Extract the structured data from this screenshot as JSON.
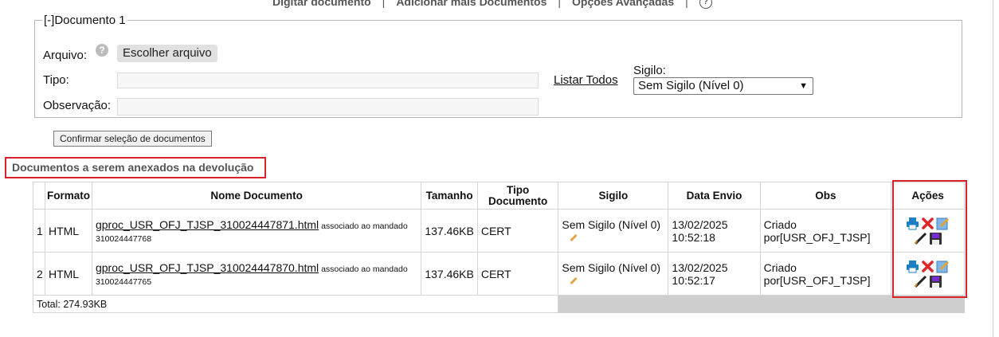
{
  "top_nav": {
    "items": [
      "Digitar documento",
      "Adicionar mais Documentos",
      "Opções Avançadas"
    ],
    "help": "?"
  },
  "fieldset": {
    "legend": "[-]Documento 1"
  },
  "form": {
    "arquivo_label": "Arquivo:",
    "help_icon": "?",
    "file_button": "Escolher arquivo",
    "tipo_label": "Tipo:",
    "tipo_value": "",
    "obs_label": "Observação:",
    "obs_value": "",
    "listar_todos": "Listar Todos",
    "sigilo_label": "Sigilo:",
    "sigilo_value": "Sem Sigilo (Nível 0)"
  },
  "confirm_button": "Confirmar seleção de documentos",
  "section_title": "Documentos a serem anexados na devolução",
  "table": {
    "headers": {
      "formato": "Formato",
      "nome": "Nome Documento",
      "tamanho": "Tamanho",
      "tipo": "Tipo Documento",
      "sigilo": "Sigilo",
      "data": "Data Envio",
      "obs": "Obs",
      "acoes": "Ações"
    },
    "rows": [
      {
        "index": "1",
        "formato": "HTML",
        "file_link": "gproc_USR_OFJ_TJSP_310024447871.html",
        "assoc": " associado ao mandado",
        "mandado": "310024447768",
        "tamanho": "137.46KB",
        "tipo": "CERT",
        "sigilo": "Sem Sigilo (Nível 0)",
        "data1": "13/02/2025",
        "data2": "10:52:18",
        "obs1": "Criado",
        "obs2": "por[USR_OFJ_TJSP]"
      },
      {
        "index": "2",
        "formato": "HTML",
        "file_link": "gproc_USR_OFJ_TJSP_310024447870.html",
        "assoc": " associado ao mandado",
        "mandado": "310024447765",
        "tamanho": "137.46KB",
        "tipo": "CERT",
        "sigilo": "Sem Sigilo (Nível 0)",
        "data1": "13/02/2025",
        "data2": "10:52:17",
        "obs1": "Criado",
        "obs2": "por[USR_OFJ_TJSP]"
      }
    ],
    "total": "Total: 274.93KB"
  },
  "action_icons": [
    "print-icon",
    "delete-icon",
    "edit-icon",
    "sign-icon",
    "save-icon"
  ],
  "colors": {
    "highlight_border": "#d9232b",
    "print_blue": "#1a7fc4",
    "delete_red": "#e0242a",
    "save_purple": "#7a2bd1"
  }
}
